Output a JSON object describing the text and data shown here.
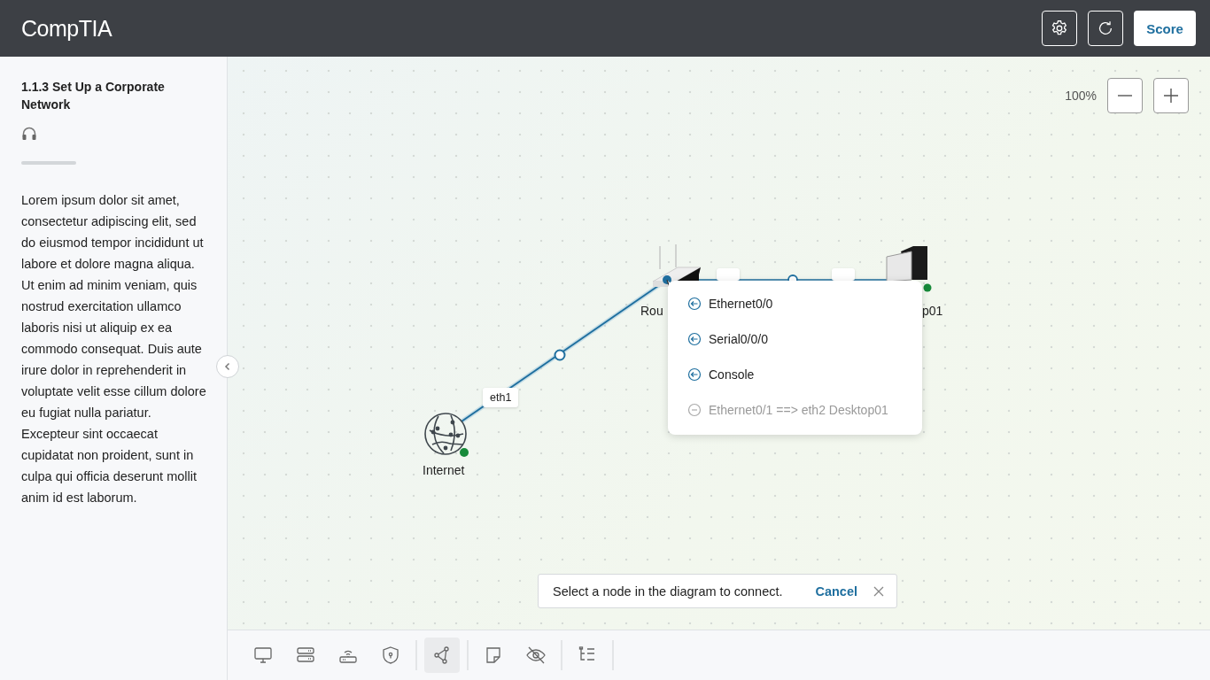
{
  "header": {
    "logo": "CompTIA",
    "score_button": "Score"
  },
  "sidebar": {
    "title": "1.1.3 Set Up a Corporate Network",
    "body": "Lorem ipsum dolor sit amet, consectetur adipiscing elit, sed do eiusmod tempor incididunt ut labore et dolore magna aliqua. Ut enim ad minim veniam, quis nostrud exercitation ullamco laboris nisi ut aliquip ex ea commodo consequat. Duis aute irure dolor in reprehenderit in voluptate velit esse cillum dolore eu fugiat nulla pariatur. Excepteur sint occaecat cupidatat non proident, sunt in culpa qui officia deserunt mollit anim id est laborum."
  },
  "canvas": {
    "zoom": "100%",
    "nodes": [
      {
        "kind": "globe",
        "label": "Internet",
        "online": true
      },
      {
        "kind": "router",
        "label": "Rou",
        "online": false
      },
      {
        "kind": "desktop",
        "label": "p01",
        "online": true
      }
    ],
    "links": [
      {
        "label": "eth1"
      }
    ],
    "port_menu": [
      {
        "label": "Ethernet0/0",
        "disabled": false
      },
      {
        "label": "Serial0/0/0",
        "disabled": false
      },
      {
        "label": "Console",
        "disabled": false
      },
      {
        "label": "Ethernet0/1 ==> eth2 Desktop01",
        "disabled": true
      }
    ],
    "toast": {
      "message": "Select a node in the diagram to connect.",
      "action": "Cancel"
    }
  },
  "toolbar": [
    {
      "tools": [
        {
          "kind": "desktop",
          "selected": false
        },
        {
          "kind": "server",
          "selected": false
        },
        {
          "kind": "router",
          "selected": false
        },
        {
          "kind": "firewall",
          "selected": false
        }
      ]
    },
    {
      "tools": [
        {
          "kind": "connect",
          "selected": true
        }
      ]
    },
    {
      "tools": [
        {
          "kind": "note",
          "selected": false
        },
        {
          "kind": "hide",
          "selected": false
        }
      ]
    },
    {
      "tools": [
        {
          "kind": "outline",
          "selected": false
        }
      ]
    }
  ]
}
